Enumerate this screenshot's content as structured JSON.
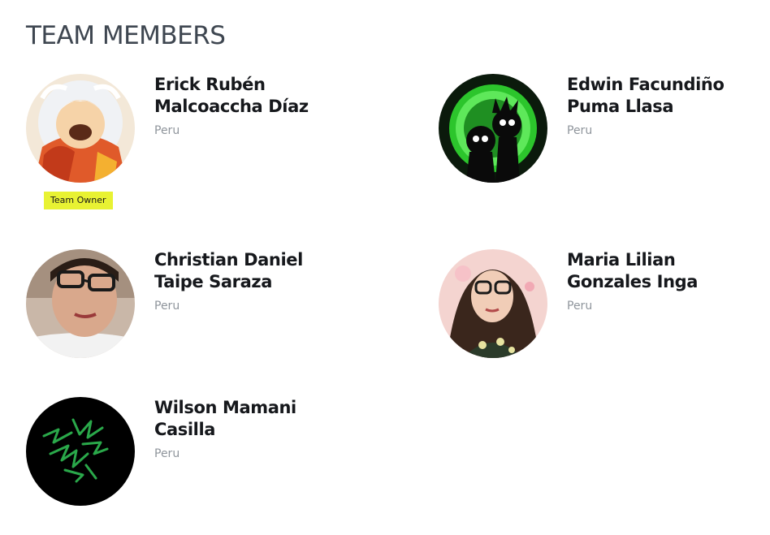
{
  "section": {
    "title": "TEAM MEMBERS"
  },
  "members": [
    {
      "name_line1": "Erick Rubén",
      "name_line2": "Malcoaccha Díaz",
      "country": "Peru",
      "badge": "Team Owner",
      "avatar_icon": "anime-character-avatar"
    },
    {
      "name_line1": "Edwin Facundiño",
      "name_line2": "Puma Llasa",
      "country": "Peru",
      "avatar_icon": "green-portal-avatar"
    },
    {
      "name_line1": "Christian Daniel",
      "name_line2": "Taipe Saraza",
      "country": "Peru",
      "avatar_icon": "person-glasses-avatar"
    },
    {
      "name_line1": "Maria Lilian",
      "name_line2": "Gonzales Inga",
      "country": "Peru",
      "avatar_icon": "person-curly-hair-avatar"
    },
    {
      "name_line1": "Wilson Mamani",
      "name_line2": "Casilla",
      "country": "Peru",
      "avatar_icon": "green-scribble-avatar"
    }
  ],
  "colors": {
    "title": "#3e4650",
    "name": "#16181c",
    "country": "#8f959c",
    "badge_bg": "#e8f233"
  }
}
